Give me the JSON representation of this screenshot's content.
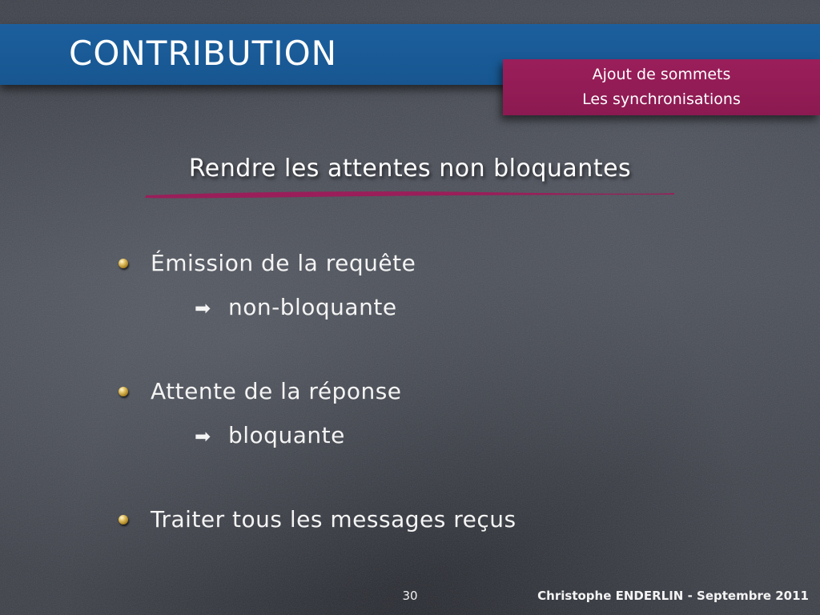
{
  "slide": {
    "title": "CONTRIBUTION",
    "section_lines": [
      "Ajout de sommets",
      "Les synchronisations"
    ],
    "subtitle": "Rendre les attentes non bloquantes",
    "bullets": [
      {
        "text": "Émission de la requête",
        "detail": "non-bloquante"
      },
      {
        "text": "Attente de la réponse",
        "detail": "bloquante"
      },
      {
        "text": "Traiter tous les messages reçus"
      }
    ],
    "arrow_symbol": "➡",
    "page_number": "30",
    "footer": "Christophe ENDERLIN  - Septembre 2011"
  },
  "colors": {
    "title_band": "#1c5f9e",
    "section_box": "#9a1e5a",
    "underline": "#9a1e5a",
    "background": "#42454e"
  }
}
